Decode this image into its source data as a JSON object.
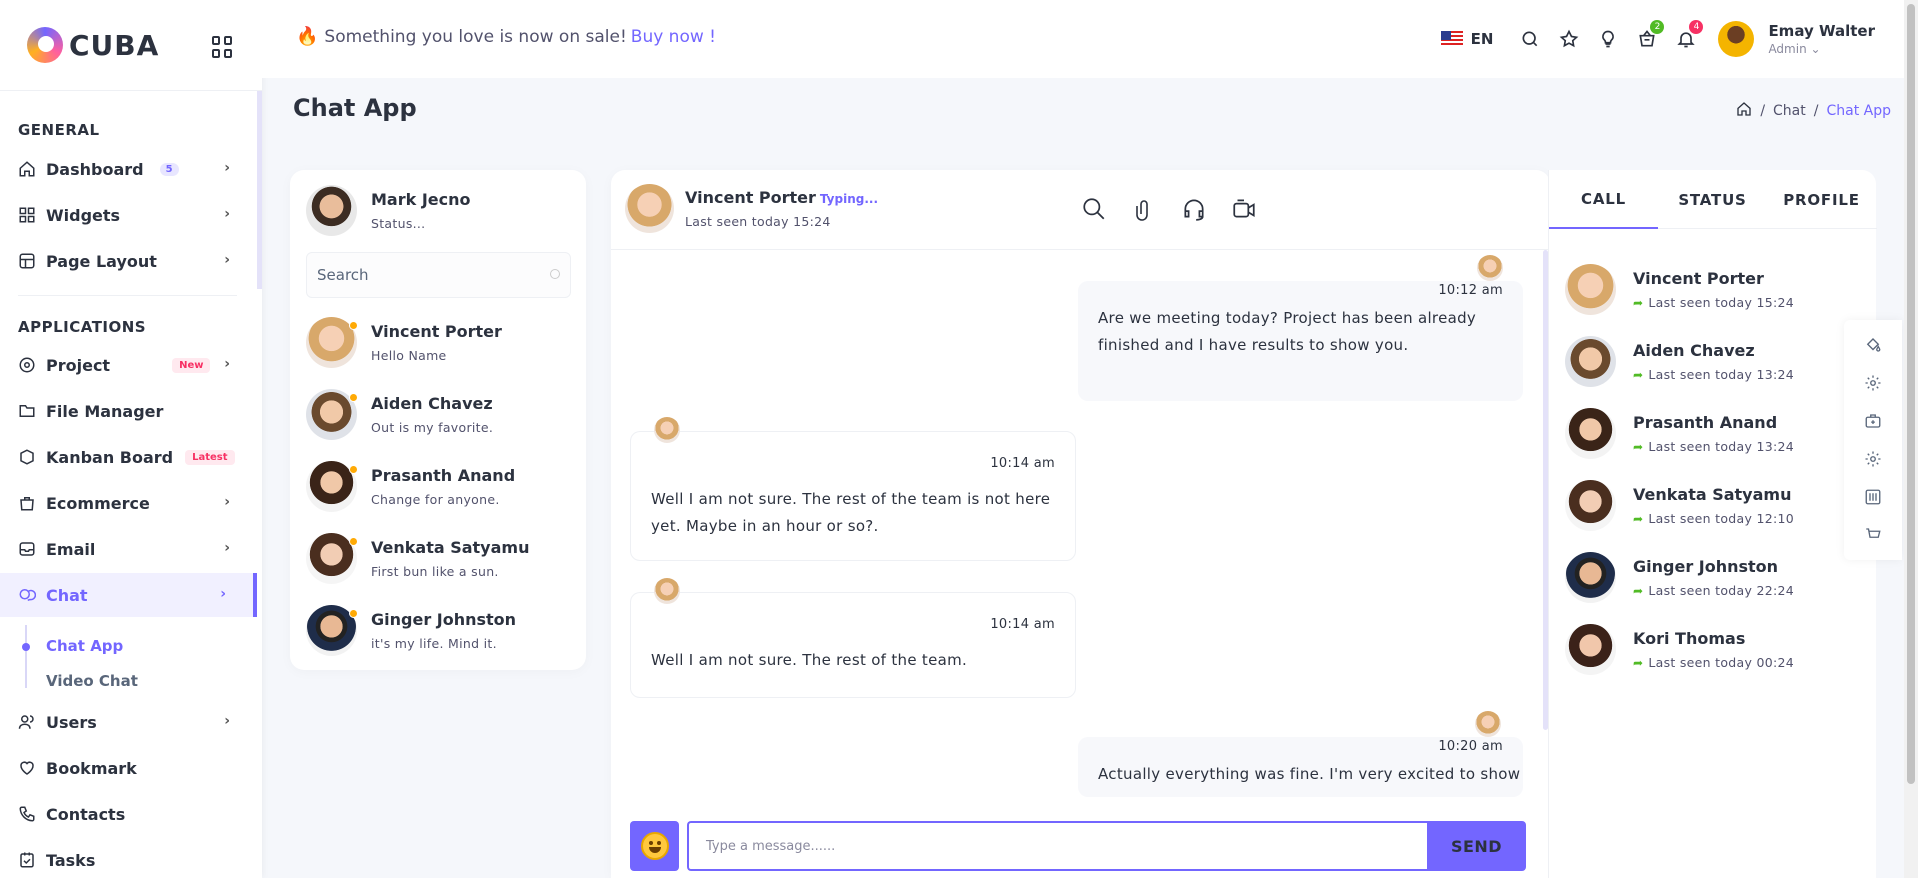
{
  "app": {
    "logo": "CUBA"
  },
  "header": {
    "promo_text": "Something you love is now on sale!",
    "promo_link": "Buy now !",
    "language": "EN",
    "cart_count": "2",
    "notification_count": "4",
    "user_name": "Emay Walter",
    "user_role": "Admin"
  },
  "sidebar": {
    "section_general": "GENERAL",
    "section_applications": "APPLICATIONS",
    "items": [
      {
        "label": "Dashboard",
        "badge": "5",
        "icon": "home-icon"
      },
      {
        "label": "Widgets",
        "icon": "widgets-icon"
      },
      {
        "label": "Page Layout",
        "icon": "layout-icon"
      },
      {
        "label": "Project",
        "badge": "New",
        "icon": "project-icon"
      },
      {
        "label": "File Manager",
        "icon": "file-icon"
      },
      {
        "label": "Kanban Board",
        "badge": "Latest",
        "icon": "kanban-icon"
      },
      {
        "label": "Ecommerce",
        "icon": "bag-icon"
      },
      {
        "label": "Email",
        "icon": "email-icon"
      },
      {
        "label": "Chat",
        "icon": "chat-icon"
      },
      {
        "label": "Users",
        "icon": "users-icon"
      },
      {
        "label": "Bookmark",
        "icon": "heart-icon"
      },
      {
        "label": "Contacts",
        "icon": "phone-icon"
      },
      {
        "label": "Tasks",
        "icon": "tasks-icon"
      }
    ],
    "chat_sub": [
      "Chat App",
      "Video Chat"
    ]
  },
  "page": {
    "title": "Chat App",
    "breadcrumb": [
      "Chat",
      "Chat App"
    ]
  },
  "contacts": {
    "me": {
      "name": "Mark Jecno",
      "status": "Status..."
    },
    "search_placeholder": "Search",
    "list": [
      {
        "name": "Vincent Porter",
        "status": "Hello Name"
      },
      {
        "name": "Aiden Chavez",
        "status": "Out is my favorite."
      },
      {
        "name": "Prasanth Anand",
        "status": "Change for anyone."
      },
      {
        "name": "Venkata Satyamu",
        "status": "First bun like a sun."
      },
      {
        "name": "Ginger Johnston",
        "status": "it's my life. Mind it."
      }
    ]
  },
  "chat": {
    "partner": "Vincent Porter",
    "typing": "Typing...",
    "last_seen": "Last seen today 15:24",
    "messages": [
      {
        "side": "right",
        "time": "10:12 am",
        "lines": [
          "Are we meeting today? Project has been already",
          "finished and I have results to show you."
        ]
      },
      {
        "side": "left",
        "time": "10:14 am",
        "lines": [
          "Well I am not sure. The rest of the team is not here",
          "yet. Maybe in an hour or so?."
        ]
      },
      {
        "side": "left",
        "time": "10:14 am",
        "lines": [
          "Well I am not sure. The rest of the team."
        ]
      },
      {
        "side": "right",
        "time": "10:20 am",
        "lines": [
          "Actually everything was fine. I'm very excited to show"
        ]
      }
    ],
    "input_placeholder": "Type a message......",
    "send_label": "SEND"
  },
  "right_panel": {
    "tabs": [
      "CALL",
      "STATUS",
      "PROFILE"
    ],
    "active_tab": "CALL",
    "calls": [
      {
        "name": "Vincent Porter",
        "seen": "Last seen today 15:24"
      },
      {
        "name": "Aiden Chavez",
        "seen": "Last seen today 13:24"
      },
      {
        "name": "Prasanth Anand",
        "seen": "Last seen today 13:24"
      },
      {
        "name": "Venkata Satyamu",
        "seen": "Last seen today 12:10"
      },
      {
        "name": "Ginger Johnston",
        "seen": "Last seen today 22:24"
      },
      {
        "name": "Kori Thomas",
        "seen": "Last seen today 00:24"
      }
    ]
  },
  "colors": {
    "accent": "#7366ff",
    "online": "#ffaa05",
    "success": "#51bb25",
    "danger": "#f73164"
  }
}
